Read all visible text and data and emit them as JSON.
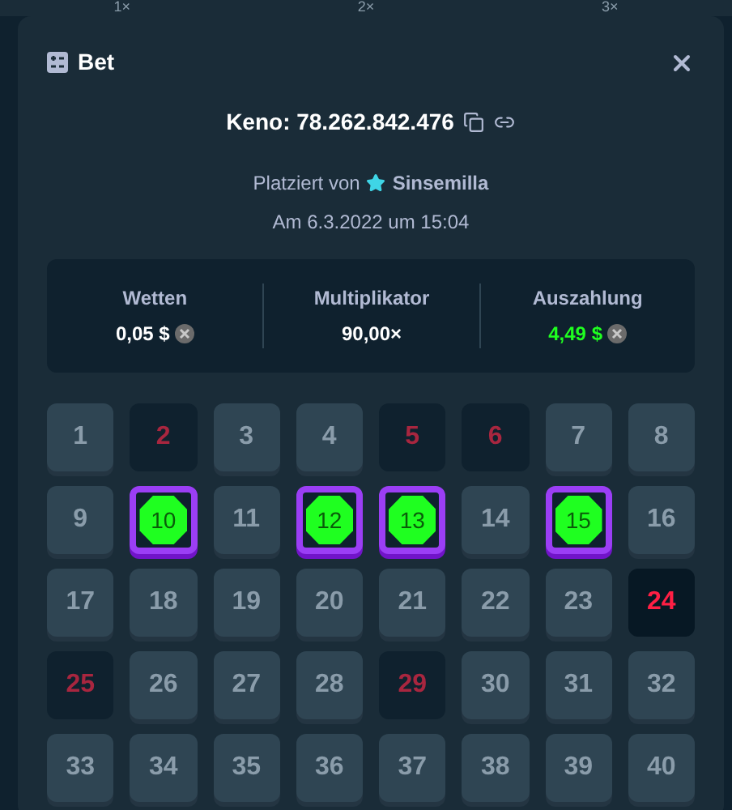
{
  "background_bar": {
    "labels": [
      "1×",
      "2×",
      "3×"
    ]
  },
  "modal": {
    "title": "Bet",
    "game": "Keno: 78.262.842.476",
    "placed_by": "Platziert von",
    "user": "Sinsemilla",
    "date": "Am 6.3.2022 um 15:04"
  },
  "stats": [
    {
      "label": "Wetten",
      "value": "0,05 $",
      "coin": true,
      "win": false
    },
    {
      "label": "Multiplikator",
      "value": "90,00×",
      "coin": false,
      "win": false
    },
    {
      "label": "Auszahlung",
      "value": "4,49 $",
      "coin": true,
      "win": true
    }
  ],
  "tiles": [
    {
      "number": "1",
      "kind": "plain"
    },
    {
      "number": "2",
      "kind": "miss"
    },
    {
      "number": "3",
      "kind": "plain"
    },
    {
      "number": "4",
      "kind": "plain"
    },
    {
      "number": "5",
      "kind": "miss"
    },
    {
      "number": "6",
      "kind": "miss"
    },
    {
      "number": "7",
      "kind": "plain"
    },
    {
      "number": "8",
      "kind": "plain"
    },
    {
      "number": "9",
      "kind": "plain"
    },
    {
      "number": "10",
      "kind": "hit"
    },
    {
      "number": "11",
      "kind": "plain"
    },
    {
      "number": "12",
      "kind": "hit"
    },
    {
      "number": "13",
      "kind": "hit"
    },
    {
      "number": "14",
      "kind": "plain"
    },
    {
      "number": "15",
      "kind": "hit"
    },
    {
      "number": "16",
      "kind": "plain"
    },
    {
      "number": "17",
      "kind": "plain"
    },
    {
      "number": "18",
      "kind": "plain"
    },
    {
      "number": "19",
      "kind": "plain"
    },
    {
      "number": "20",
      "kind": "plain"
    },
    {
      "number": "21",
      "kind": "plain"
    },
    {
      "number": "22",
      "kind": "plain"
    },
    {
      "number": "23",
      "kind": "plain"
    },
    {
      "number": "24",
      "kind": "miss_bright"
    },
    {
      "number": "25",
      "kind": "miss"
    },
    {
      "number": "26",
      "kind": "plain"
    },
    {
      "number": "27",
      "kind": "plain"
    },
    {
      "number": "28",
      "kind": "plain"
    },
    {
      "number": "29",
      "kind": "miss"
    },
    {
      "number": "30",
      "kind": "plain"
    },
    {
      "number": "31",
      "kind": "plain"
    },
    {
      "number": "32",
      "kind": "plain"
    },
    {
      "number": "33",
      "kind": "plain"
    },
    {
      "number": "34",
      "kind": "plain"
    },
    {
      "number": "35",
      "kind": "plain"
    },
    {
      "number": "36",
      "kind": "plain"
    },
    {
      "number": "37",
      "kind": "plain"
    },
    {
      "number": "38",
      "kind": "plain"
    },
    {
      "number": "39",
      "kind": "plain"
    },
    {
      "number": "40",
      "kind": "plain"
    }
  ]
}
